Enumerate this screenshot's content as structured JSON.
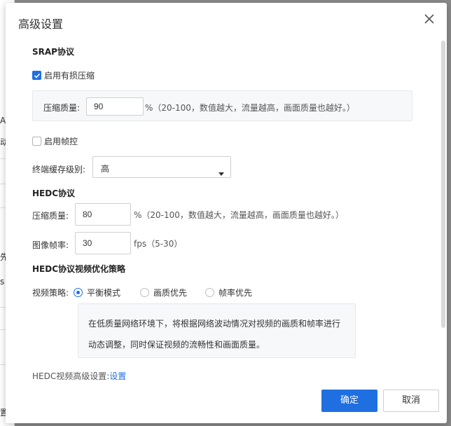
{
  "background_fragments": [
    "A",
    "动",
    "先",
    "s",
    "置"
  ],
  "dialog": {
    "title": "高级设置",
    "close_icon": "close-icon"
  },
  "srap": {
    "section_title": "SRAP协议",
    "lossy_compression": {
      "label": "启用有损压缩",
      "checked": true
    },
    "compression_quality": {
      "label": "压缩质量:",
      "value": "90",
      "unit_hint": "%（20-100，数值越大，流量越高，画面质量也越好。）"
    },
    "frame_control": {
      "label": "启用帧控",
      "checked": false
    },
    "terminal_cache": {
      "label": "终端缓存级别:",
      "selected": "高"
    }
  },
  "hedc": {
    "section_title": "HEDC协议",
    "compression_quality": {
      "label": "压缩质量:",
      "value": "80",
      "unit_hint": "%（20-100，数值越大，流量越高，画面质量也越好。）"
    },
    "frame_rate": {
      "label": "图像帧率:",
      "value": "30",
      "unit_hint": "fps（5-30）"
    }
  },
  "strategy": {
    "section_title": "HEDC协议视频优化策略",
    "label": "视频策略:",
    "options": [
      {
        "label": "平衡模式",
        "selected": true
      },
      {
        "label": "画质优先",
        "selected": false
      },
      {
        "label": "帧率优先",
        "selected": false
      }
    ],
    "description_line1": "在低质量网络环境下，将根据网络波动情况对视频的画质和帧率进行",
    "description_line2": "动态调整，同时保证视频的流畅性和画面质量。"
  },
  "advanced": {
    "label": "HEDC视频高级设置:",
    "link": "设置"
  },
  "footer": {
    "confirm_label": "确定",
    "cancel_label": "取消"
  },
  "colors": {
    "accent": "#1f6fe0",
    "panel_bg": "#f7f8fa"
  }
}
